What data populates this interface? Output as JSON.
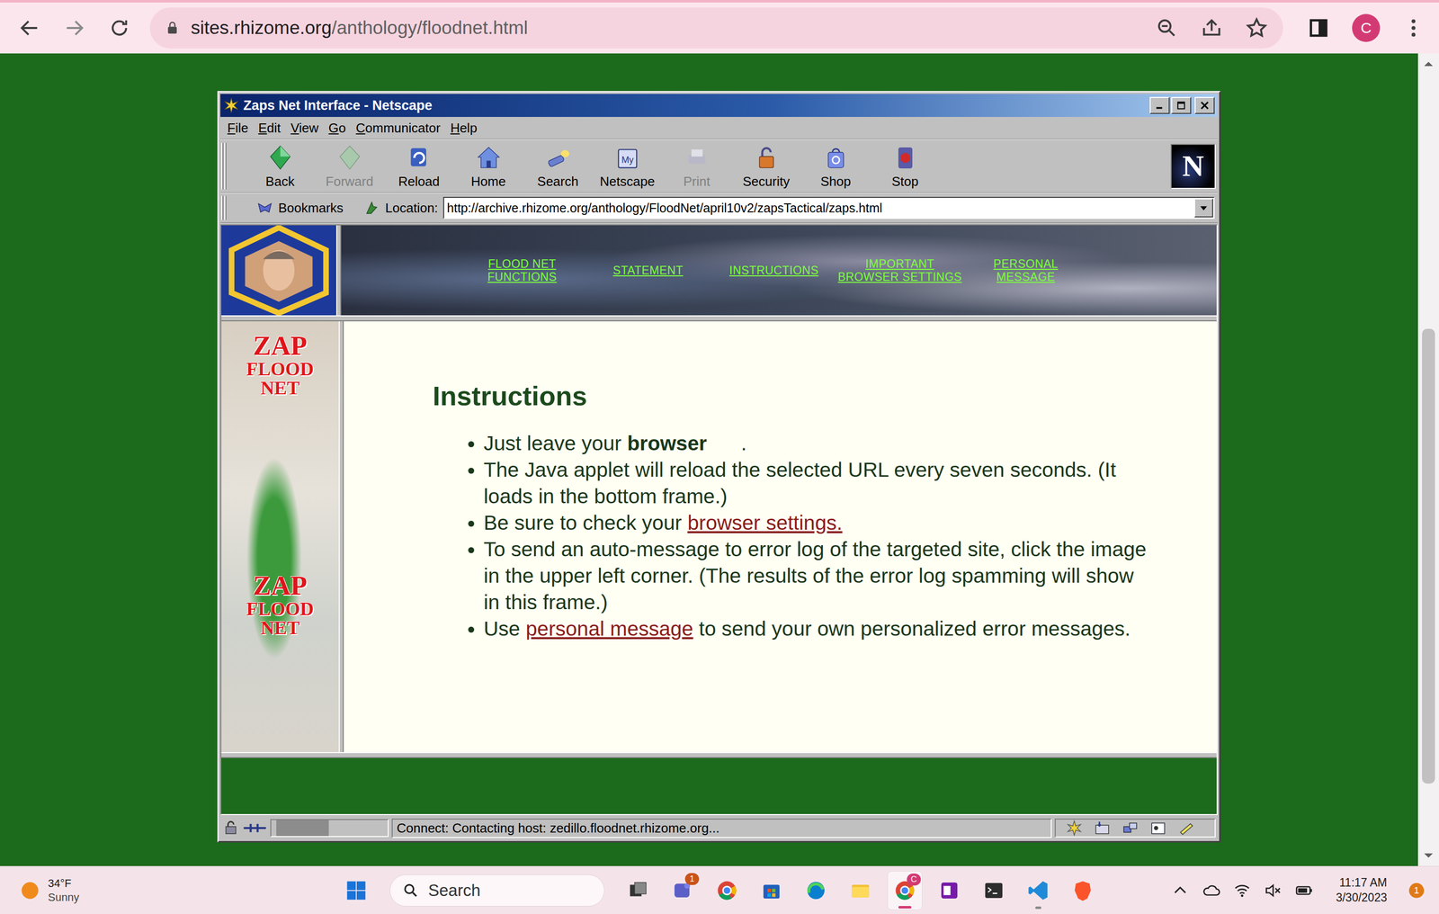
{
  "browser": {
    "url_host": "sites.rhizome.org",
    "url_path": "/anthology/floodnet.html",
    "profile": "C"
  },
  "page_scrollbar": {
    "offset": 0.33,
    "size": 0.59
  },
  "window": {
    "title": "Zaps Net Interface - Netscape",
    "logo": "N"
  },
  "menu": [
    "File",
    "Edit",
    "View",
    "Go",
    "Communicator",
    "Help"
  ],
  "toolbar": [
    {
      "label": "Back",
      "disabled": false
    },
    {
      "label": "Forward",
      "disabled": true
    },
    {
      "label": "Reload",
      "disabled": false
    },
    {
      "label": "Home",
      "disabled": false
    },
    {
      "label": "Search",
      "disabled": false
    },
    {
      "label": "Netscape",
      "disabled": false,
      "mark": "My"
    },
    {
      "label": "Print",
      "disabled": true
    },
    {
      "label": "Security",
      "disabled": false
    },
    {
      "label": "Shop",
      "disabled": false
    },
    {
      "label": "Stop",
      "disabled": false
    }
  ],
  "location_bar": {
    "bookmarks": "Bookmarks",
    "label": "Location:",
    "url": "http://archive.rhizome.org/anthology/FloodNet/april10v2/zapsTactical/zaps.html"
  },
  "nav_links": [
    "FLOOD NET FUNCTIONS",
    "STATEMENT",
    "INSTRUCTIONS",
    "IMPORTANT BROWSER SETTINGS",
    "PERSONAL MESSAGE"
  ],
  "sidebar": {
    "logos": [
      [
        "ZAP",
        "FLOOD",
        "NET"
      ],
      [
        "ZAP",
        "FLOOD",
        "NET"
      ]
    ]
  },
  "content": {
    "heading": "Instructions",
    "bullets": [
      [
        {
          "kind": "text",
          "text": "Just leave your "
        },
        {
          "kind": "bold",
          "text": "browser"
        },
        {
          "kind": "text",
          "text": "      ."
        }
      ],
      [
        {
          "kind": "text",
          "text": "The Java applet will reload the selected URL every seven seconds. (It loads in the bottom frame.)"
        }
      ],
      [
        {
          "kind": "text",
          "text": "Be sure to check your "
        },
        {
          "kind": "link",
          "text": "browser settings."
        }
      ],
      [
        {
          "kind": "text",
          "text": "To send an auto-message to error log of the targeted site, click the image in the upper left corner. (The results of the error log spamming will show in this frame.)"
        }
      ],
      [
        {
          "kind": "text",
          "text": "Use "
        },
        {
          "kind": "link",
          "text": "personal message"
        },
        {
          "kind": "text",
          "text": " to send your own personalized error messages."
        }
      ]
    ]
  },
  "status_bar": {
    "progress": {
      "level": 0.45
    },
    "text": "Connect: Contacting host: zedillo.floodnet.rhizome.org..."
  },
  "taskbar": {
    "weather": {
      "temp": "34°F",
      "condition": "Sunny"
    },
    "search": "Search",
    "apps": [
      {
        "badge": null,
        "active": false,
        "running": false
      },
      {
        "badge": "1",
        "active": false,
        "running": false
      },
      {
        "badge": null,
        "active": false,
        "running": false
      },
      {
        "badge": null,
        "active": false,
        "running": false
      },
      {
        "badge": null,
        "active": false,
        "running": false
      },
      {
        "badge": null,
        "active": false,
        "running": false
      },
      {
        "badge": "C",
        "active": true,
        "running": true
      },
      {
        "badge": null,
        "active": false,
        "running": false
      },
      {
        "badge": null,
        "active": false,
        "running": false
      },
      {
        "badge": null,
        "active": false,
        "running": true
      },
      {
        "badge": null,
        "active": false,
        "running": false
      }
    ],
    "clock": {
      "time": "11:17 AM",
      "date": "3/30/2023"
    },
    "notifications": "1"
  }
}
